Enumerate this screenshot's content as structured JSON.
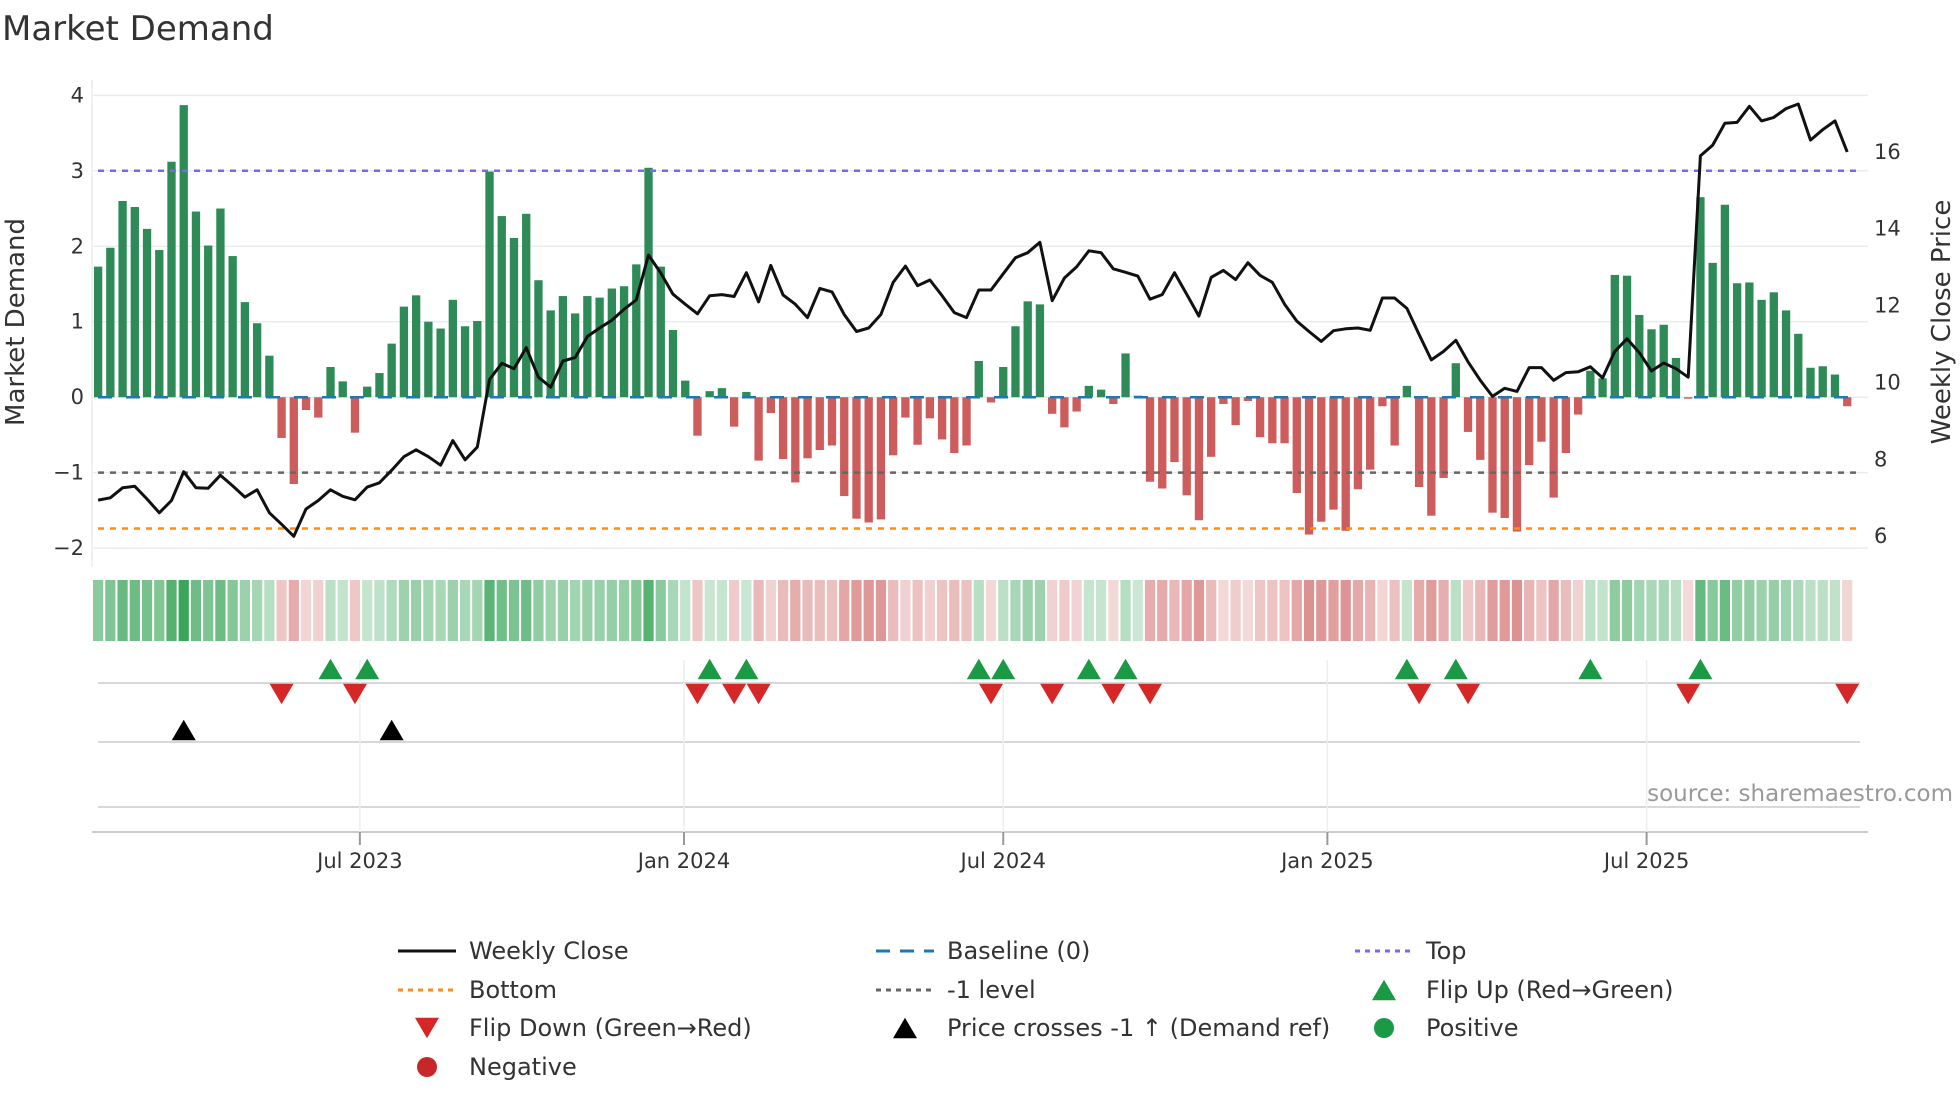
{
  "title": "Market Demand",
  "source": "source: sharemaestro.com",
  "colors": {
    "bar_positive": "#2e8b57",
    "bar_negative": "#cd5c5c",
    "close_line": "#111111",
    "baseline": "#1f77b4",
    "top": "#7b68ee",
    "bottom": "#ff8c1a",
    "minus_one": "#666666",
    "flip_up": "#1a9a45",
    "flip_down": "#d62728",
    "cross": "#000000",
    "positive_dot": "#1a9a45",
    "negative_dot": "#c62828"
  },
  "legend": [
    {
      "label": "Weekly Close",
      "symbol": "line-solid",
      "color": "#111111"
    },
    {
      "label": "Baseline (0)",
      "symbol": "line-dash",
      "color": "#1f77b4"
    },
    {
      "label": "Top",
      "symbol": "line-dot",
      "color": "#7b68ee"
    },
    {
      "label": "Bottom",
      "symbol": "line-dot",
      "color": "#ff8c1a"
    },
    {
      "label": "-1 level",
      "symbol": "line-dot",
      "color": "#666666"
    },
    {
      "label": "Flip Up (Red→Green)",
      "symbol": "triangle-up",
      "color": "#1a9a45"
    },
    {
      "label": "Flip Down (Green→Red)",
      "symbol": "triangle-down",
      "color": "#d62728"
    },
    {
      "label": "Price crosses -1 ↑ (Demand ref)",
      "symbol": "triangle-up",
      "color": "#000000"
    },
    {
      "label": "Positive",
      "symbol": "circle",
      "color": "#1a9a45"
    },
    {
      "label": "Negative",
      "symbol": "circle",
      "color": "#c62828"
    }
  ],
  "chart_data": {
    "type": "bar",
    "title": "Market Demand",
    "ylabel": "Market Demand",
    "y2label": "Weekly Close Price",
    "frequency": "weekly",
    "ylim": [
      -2.25,
      4.15
    ],
    "y2lim": [
      5.17,
      17.74
    ],
    "yticks": [
      -2,
      -1,
      0,
      1,
      2,
      3,
      4
    ],
    "ytick_labels": [
      "−2",
      "−1",
      "0",
      "1",
      "2",
      "3",
      "4"
    ],
    "y2ticks": [
      6,
      8,
      10,
      12,
      14,
      16
    ],
    "y2tick_labels": [
      "6",
      "8",
      "10",
      "12",
      "14",
      "16"
    ],
    "xlim_weeks": [
      -0.5,
      144.7
    ],
    "xticks": [
      {
        "label": "Jul 2023",
        "week_index": 21.4
      },
      {
        "label": "Jan 2024",
        "week_index": 47.9
      },
      {
        "label": "Jul 2024",
        "week_index": 74.0
      },
      {
        "label": "Jan 2025",
        "week_index": 100.5
      },
      {
        "label": "Jul 2025",
        "week_index": 126.6
      }
    ],
    "reference_lines": {
      "top": 3.0,
      "baseline": 0,
      "minus_one": -1.0,
      "bottom": -1.74
    },
    "grid": true,
    "legend_placement": "bottom",
    "demand": [
      1.73,
      1.98,
      2.6,
      2.52,
      2.23,
      1.95,
      3.12,
      3.87,
      2.46,
      2.01,
      2.5,
      1.87,
      1.26,
      0.98,
      0.55,
      -0.54,
      -1.15,
      -0.17,
      -0.27,
      0.4,
      0.21,
      -0.47,
      0.14,
      0.32,
      0.71,
      1.2,
      1.35,
      1.0,
      0.91,
      1.29,
      0.94,
      1.01,
      2.99,
      2.4,
      2.11,
      2.43,
      1.55,
      1.15,
      1.34,
      1.11,
      1.34,
      1.32,
      1.44,
      1.47,
      1.76,
      3.04,
      1.73,
      0.89,
      0.22,
      -0.51,
      0.08,
      0.12,
      -0.39,
      0.07,
      -0.84,
      -0.21,
      -0.82,
      -1.13,
      -0.81,
      -0.7,
      -0.64,
      -1.31,
      -1.61,
      -1.66,
      -1.62,
      -0.77,
      -0.27,
      -0.63,
      -0.28,
      -0.56,
      -0.74,
      -0.64,
      0.48,
      -0.07,
      0.4,
      0.94,
      1.27,
      1.23,
      -0.22,
      -0.4,
      -0.19,
      0.15,
      0.1,
      -0.09,
      0.58,
      0.02,
      -1.12,
      -1.21,
      -0.86,
      -1.3,
      -1.63,
      -0.79,
      -0.09,
      -0.37,
      -0.05,
      -0.53,
      -0.61,
      -0.61,
      -1.27,
      -1.82,
      -1.65,
      -1.49,
      -1.77,
      -1.22,
      -0.96,
      -0.12,
      -0.64,
      0.15,
      -1.19,
      -1.57,
      -1.07,
      0.45,
      -0.46,
      -0.83,
      -1.53,
      -1.6,
      -1.78,
      -0.9,
      -0.59,
      -1.33,
      -0.74,
      -0.23,
      0.35,
      0.25,
      1.62,
      1.61,
      1.09,
      0.9,
      0.96,
      0.52,
      -0.02,
      2.65,
      1.78,
      2.55,
      1.51,
      1.52,
      1.29,
      1.39,
      1.15,
      0.84,
      0.39,
      0.41,
      0.3,
      -0.12
    ],
    "weekly_close": [
      6.91,
      6.97,
      7.23,
      7.27,
      6.94,
      6.58,
      6.9,
      7.65,
      7.23,
      7.22,
      7.56,
      7.28,
      6.99,
      7.18,
      6.58,
      6.28,
      5.97,
      6.68,
      6.9,
      7.18,
      7.01,
      6.92,
      7.25,
      7.36,
      7.69,
      8.04,
      8.22,
      8.04,
      7.82,
      8.46,
      7.96,
      8.29,
      10.05,
      10.47,
      10.33,
      10.88,
      10.11,
      9.85,
      10.53,
      10.62,
      11.17,
      11.39,
      11.59,
      11.88,
      12.12,
      13.29,
      12.82,
      12.27,
      12.01,
      11.76,
      12.23,
      12.26,
      12.21,
      12.83,
      12.07,
      13.02,
      12.25,
      12.01,
      11.66,
      12.42,
      12.33,
      11.74,
      11.3,
      11.39,
      11.74,
      12.58,
      13.0,
      12.49,
      12.64,
      12.23,
      11.79,
      11.66,
      12.38,
      12.38,
      12.8,
      13.22,
      13.35,
      13.62,
      12.1,
      12.69,
      12.98,
      13.4,
      13.35,
      12.93,
      12.84,
      12.74,
      12.14,
      12.26,
      12.83,
      12.27,
      11.7,
      12.71,
      12.89,
      12.65,
      13.09,
      12.76,
      12.58,
      12.01,
      11.57,
      11.3,
      11.04,
      11.32,
      11.37,
      11.39,
      11.33,
      12.17,
      12.17,
      11.9,
      11.22,
      10.56,
      10.78,
      11.07,
      10.51,
      10.03,
      9.61,
      9.82,
      9.74,
      10.36,
      10.36,
      10.03,
      10.23,
      10.25,
      10.38,
      10.09,
      10.78,
      11.11,
      10.75,
      10.27,
      10.48,
      10.33,
      10.11,
      15.87,
      16.15,
      16.72,
      16.74,
      17.16,
      16.78,
      16.87,
      17.1,
      17.22,
      16.28,
      16.55,
      16.78,
      15.97
    ],
    "price_cross_indices": [
      7,
      24
    ]
  }
}
